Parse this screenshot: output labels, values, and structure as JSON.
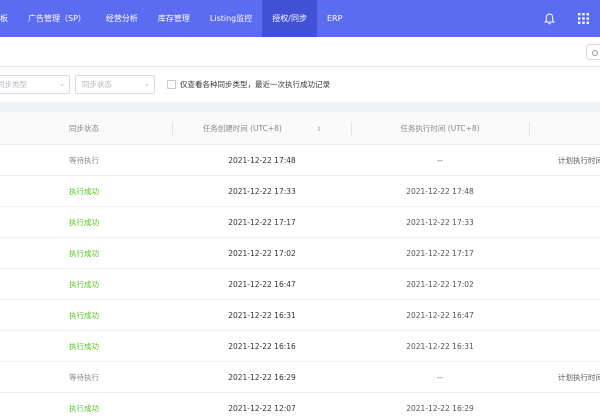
{
  "nav": {
    "items": [
      {
        "label": "看板",
        "active": false
      },
      {
        "label": "广告管理（SP）",
        "active": false
      },
      {
        "label": "经营分析",
        "active": false
      },
      {
        "label": "库存管理",
        "active": false
      },
      {
        "label": "Listing监控",
        "active": false
      },
      {
        "label": "授权/同步",
        "active": true
      },
      {
        "label": "ERP",
        "active": false
      }
    ],
    "icons": [
      "bell-icon",
      "grid-icon"
    ]
  },
  "filters": {
    "sync_type_placeholder": "同步类型",
    "sync_status_placeholder": "同步状态",
    "only_latest_label": "仅查看各种同步类型，最近一次执行成功记录"
  },
  "table": {
    "headers": {
      "status": "同步状态",
      "create_time": "任务创建时间 (UTC+8)",
      "exec_time": "任务执行时间 (UTC+8)"
    },
    "rows": [
      {
        "status": "等待执行",
        "state": "wait",
        "create": "2021-12-22 17:48",
        "exec": "--",
        "note": "计划执行时间"
      },
      {
        "status": "执行成功",
        "state": "ok",
        "create": "2021-12-22 17:33",
        "exec": "2021-12-22 17:48",
        "note": ""
      },
      {
        "status": "执行成功",
        "state": "ok",
        "create": "2021-12-22 17:17",
        "exec": "2021-12-22 17:33",
        "note": ""
      },
      {
        "status": "执行成功",
        "state": "ok",
        "create": "2021-12-22 17:02",
        "exec": "2021-12-22 17:17",
        "note": ""
      },
      {
        "status": "执行成功",
        "state": "ok",
        "create": "2021-12-22 16:47",
        "exec": "2021-12-22 17:02",
        "note": ""
      },
      {
        "status": "执行成功",
        "state": "ok",
        "create": "2021-12-22 16:31",
        "exec": "2021-12-22 16:47",
        "note": ""
      },
      {
        "status": "执行成功",
        "state": "ok",
        "create": "2021-12-22 16:16",
        "exec": "2021-12-22 16:31",
        "note": ""
      },
      {
        "status": "等待执行",
        "state": "wait",
        "create": "2021-12-22 16:29",
        "exec": "--",
        "note": "计划执行时间"
      },
      {
        "status": "执行成功",
        "state": "ok",
        "create": "2021-12-22 12:07",
        "exec": "2021-12-22 16:29",
        "note": ""
      }
    ]
  },
  "colors": {
    "nav_bg": "#5b6cf0",
    "nav_active": "#4251d6",
    "status_ok": "#52c41a",
    "status_wait": "#888888"
  }
}
